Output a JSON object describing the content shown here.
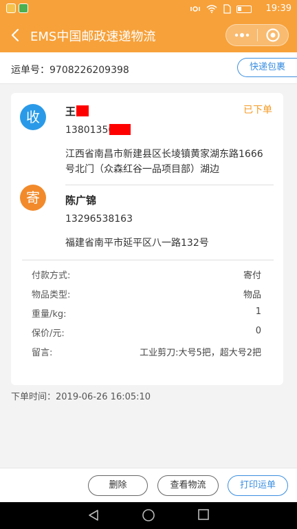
{
  "status_bar": {
    "time": "19:39"
  },
  "header": {
    "title": "EMS中国邮政速递物流"
  },
  "order": {
    "number_label": "运单号：9708226209398",
    "quick_button": "快递包裹"
  },
  "receiver": {
    "badge": "收",
    "name": "王",
    "phone": "13801356",
    "address": "江西省南昌市新建县区长堎镇黄家湖东路1666号北门（众森红谷一品项目部）湖边"
  },
  "sender": {
    "badge": "寄",
    "name": "陈广锦",
    "phone": "13296538163",
    "address": "福建省南平市延平区八一路132号"
  },
  "status": "已下单",
  "details": [
    {
      "label": "付款方式:",
      "value": "寄付"
    },
    {
      "label": "物品类型:",
      "value": "物品"
    },
    {
      "label": "重量/kg:",
      "value": "1"
    },
    {
      "label": "保价/元:",
      "value": "0"
    },
    {
      "label": "留言:",
      "value": "工业剪刀:大号5把，超大号2把"
    }
  ],
  "order_time": "下单时间：2019-06-26 16:05:10",
  "actions": {
    "delete": "删除",
    "track": "查看物流",
    "print": "打印运单"
  },
  "colors": {
    "brand": "#f7a13a",
    "accent_blue": "#3a8ee0",
    "status_orange": "#f59a23",
    "receiver_badge": "#2a9ae8",
    "sender_badge": "#f28a2b"
  }
}
